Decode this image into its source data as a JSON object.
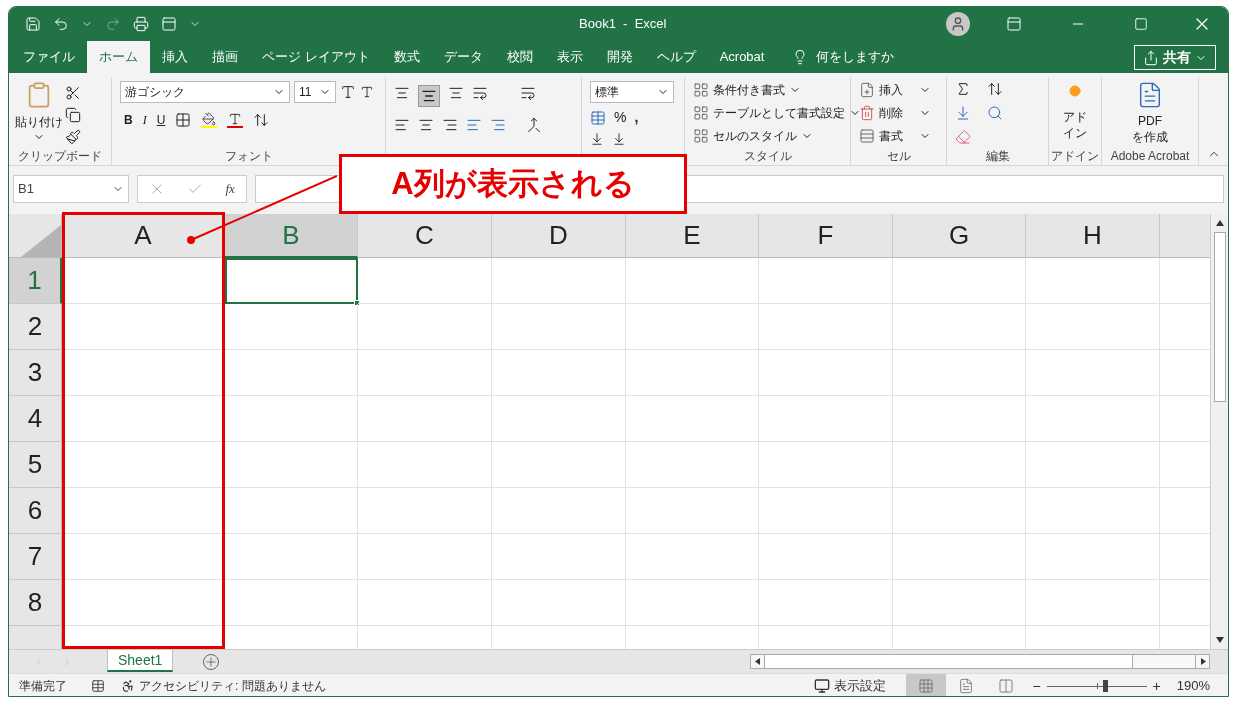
{
  "window": {
    "title": "Book1  -  Excel"
  },
  "ribbon_tabs": [
    {
      "label": "ファイル",
      "selected": false
    },
    {
      "label": "ホーム",
      "selected": true
    },
    {
      "label": "挿入",
      "selected": false
    },
    {
      "label": "描画",
      "selected": false
    },
    {
      "label": "ページ レイアウト",
      "selected": false
    },
    {
      "label": "数式",
      "selected": false
    },
    {
      "label": "データ",
      "selected": false
    },
    {
      "label": "校閲",
      "selected": false
    },
    {
      "label": "表示",
      "selected": false
    },
    {
      "label": "開発",
      "selected": false
    },
    {
      "label": "ヘルプ",
      "selected": false
    },
    {
      "label": "Acrobat",
      "selected": false
    }
  ],
  "tell_me": {
    "placeholder": "何をしますか"
  },
  "share_button": "共有",
  "ribbon": {
    "clipboard": {
      "paste": "貼り付け",
      "label": "クリップボード"
    },
    "font": {
      "name": "游ゴシック",
      "size": "11",
      "bold": "B",
      "italic": "I",
      "underline": "U",
      "label": "フォント"
    },
    "number": {
      "format": "標準",
      "percent": "%",
      "comma": ","
    },
    "styles": {
      "items": [
        "条件付き書式",
        "テーブルとして書式設定",
        "セルのスタイル"
      ],
      "label": "スタイル"
    },
    "cells": {
      "items": [
        "挿入",
        "削除",
        "書式"
      ],
      "label": "セル"
    },
    "editing": {
      "label": "編集"
    },
    "addins": {
      "button": "アドイン",
      "label": "アドイン"
    },
    "acrobat": {
      "button": "PDF\nを作成",
      "label": "Adobe Acrobat"
    }
  },
  "formula_bar": {
    "name_box": "B1",
    "function_label": "fx"
  },
  "sheet": {
    "columns": [
      {
        "label": "A",
        "selected": false
      },
      {
        "label": "B",
        "selected": true
      },
      {
        "label": "C",
        "selected": false
      },
      {
        "label": "D",
        "selected": false
      },
      {
        "label": "E",
        "selected": false
      },
      {
        "label": "F",
        "selected": false
      },
      {
        "label": "G",
        "selected": false
      },
      {
        "label": "H",
        "selected": false
      }
    ],
    "rows": [
      {
        "label": "1",
        "selected": true
      },
      {
        "label": "2",
        "selected": false
      },
      {
        "label": "3",
        "selected": false
      },
      {
        "label": "4",
        "selected": false
      },
      {
        "label": "5",
        "selected": false
      },
      {
        "label": "6",
        "selected": false
      },
      {
        "label": "7",
        "selected": false
      },
      {
        "label": "8",
        "selected": false
      }
    ]
  },
  "callout": {
    "text": "A列が表示される"
  },
  "sheet_tabs": [
    {
      "label": "Sheet1",
      "selected": true
    }
  ],
  "status_bar": {
    "ready": "準備完了",
    "accessibility": "アクセシビリティ: 問題ありません",
    "display_settings": "表示設定",
    "views": [
      {
        "kind": "normal",
        "selected": true
      },
      {
        "kind": "page_layout",
        "selected": false
      },
      {
        "kind": "page_break",
        "selected": false
      }
    ],
    "zoom_out": "−",
    "zoom_in": "+",
    "zoom": {
      "level": 0.58,
      "reading": "190%"
    }
  }
}
